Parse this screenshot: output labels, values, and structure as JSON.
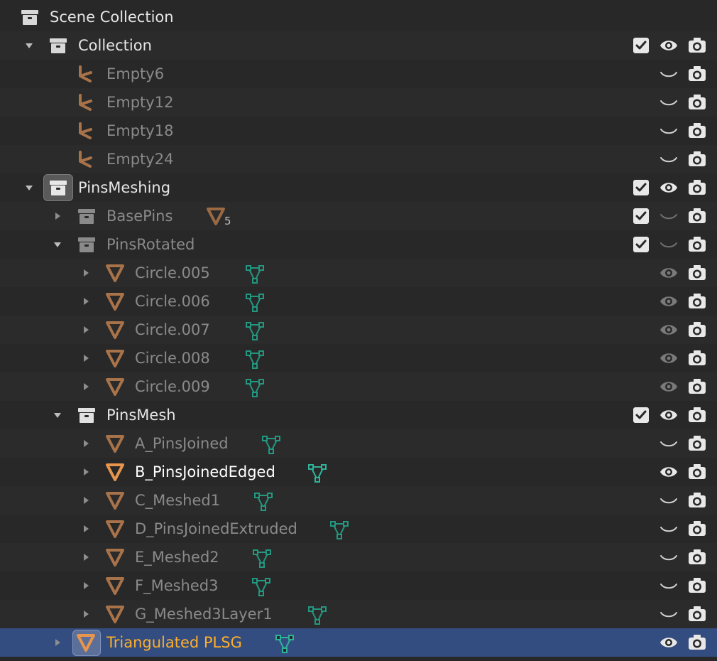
{
  "outliner": {
    "scene": {
      "label": "Scene Collection",
      "icon": "collection-icon"
    },
    "collection": {
      "label": "Collection",
      "checked": true,
      "visible": true
    },
    "empties": [
      {
        "label": "Empty6",
        "icon": "empty-axes-icon"
      },
      {
        "label": "Empty12",
        "icon": "empty-axes-icon"
      },
      {
        "label": "Empty18",
        "icon": "empty-axes-icon"
      },
      {
        "label": "Empty24",
        "icon": "empty-axes-icon"
      }
    ],
    "pinsmeshing": {
      "label": "PinsMeshing",
      "checked": true,
      "visible": true
    },
    "basepins": {
      "label": "BasePins",
      "child_count": "5",
      "checked": true,
      "visible": false
    },
    "pinsrotated": {
      "label": "PinsRotated",
      "checked": true,
      "visible": false
    },
    "circles": [
      {
        "label": "Circle.005"
      },
      {
        "label": "Circle.006"
      },
      {
        "label": "Circle.007"
      },
      {
        "label": "Circle.008"
      },
      {
        "label": "Circle.009"
      }
    ],
    "pinsmesh": {
      "label": "PinsMesh",
      "checked": true,
      "visible": true
    },
    "meshes": [
      {
        "label": "A_PinsJoined",
        "visible": false
      },
      {
        "label": "B_PinsJoinedEdged",
        "visible": true
      },
      {
        "label": "C_Meshed1",
        "visible": false
      },
      {
        "label": "D_PinsJoinedExtruded",
        "visible": false
      },
      {
        "label": "E_Meshed2",
        "visible": false
      },
      {
        "label": "F_Meshed3",
        "visible": false
      },
      {
        "label": "G_Meshed3Layer1",
        "visible": false
      }
    ],
    "selected": {
      "label": "Triangulated PLSG",
      "visible": true
    }
  },
  "colors": {
    "background": "#282828",
    "selected_row": "#334d80",
    "selected_text": "#ffaf29",
    "object_icon": "#c87f45",
    "mesh_data": "#2fb39a",
    "empty_icon": "#a9734a"
  }
}
